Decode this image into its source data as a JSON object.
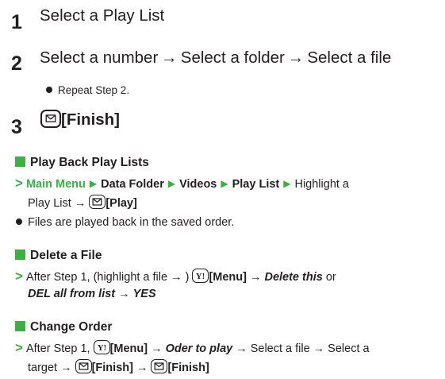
{
  "steps": [
    {
      "num": "1",
      "text": "Select a Play List"
    },
    {
      "num": "2",
      "parts": [
        "Select a number",
        "Select a folder",
        "Select a file"
      ],
      "note": "Repeat Step 2."
    },
    {
      "num": "3",
      "label": "[Finish]"
    }
  ],
  "arrow": "→",
  "section_play": {
    "title": "Play Back Play Lists",
    "path": [
      "Main Menu",
      "Data Folder",
      "Videos",
      "Play List"
    ],
    "highlight": "Highlight a",
    "line2_start": "Play List",
    "play_label": "[Play]",
    "bullet": "Files are played back in the saved order."
  },
  "section_delete": {
    "title": "Delete a File",
    "lead": "After Step 1, (highlight a file",
    "close_paren": ")",
    "menu_label": "[Menu]",
    "opt1": "Delete this",
    "or": "or",
    "opt2": "DEL all from list",
    "yes": "YES"
  },
  "section_order": {
    "title": "Change Order",
    "lead": "After Step 1,",
    "menu_label": "[Menu]",
    "opt": "Oder to play",
    "select_file": "Select a file",
    "select_a": "Select a",
    "target": "target",
    "finish_label": "[Finish]"
  },
  "colors": {
    "accent": "#3cb043",
    "text": "#231f20"
  },
  "icons": [
    "mail-key-icon",
    "yahoo-key-icon"
  ]
}
